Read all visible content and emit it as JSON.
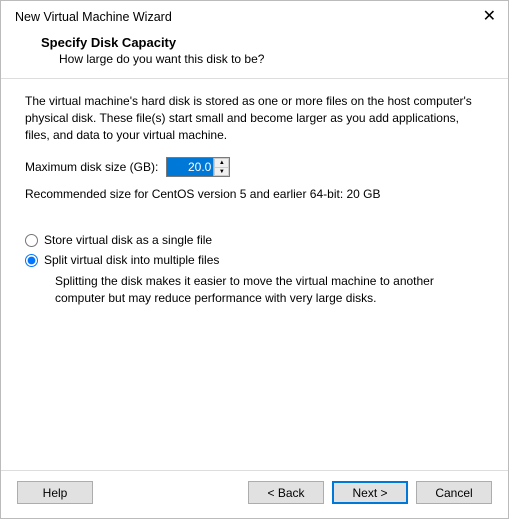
{
  "window": {
    "title": "New Virtual Machine Wizard"
  },
  "header": {
    "title": "Specify Disk Capacity",
    "subtitle": "How large do you want this disk to be?"
  },
  "content": {
    "description": "The virtual machine's hard disk is stored as one or more files on the host computer's physical disk. These file(s) start small and become larger as you add applications, files, and data to your virtual machine.",
    "disk_label": "Maximum disk size (GB):",
    "disk_value": "20.0",
    "recommended": "Recommended size for CentOS version 5 and earlier 64-bit: 20 GB",
    "radio_single": "Store virtual disk as a single file",
    "radio_split": "Split virtual disk into multiple files",
    "split_help": "Splitting the disk makes it easier to move the virtual machine to another computer but may reduce performance with very large disks."
  },
  "footer": {
    "help": "Help",
    "back": "< Back",
    "next": "Next >",
    "cancel": "Cancel"
  }
}
